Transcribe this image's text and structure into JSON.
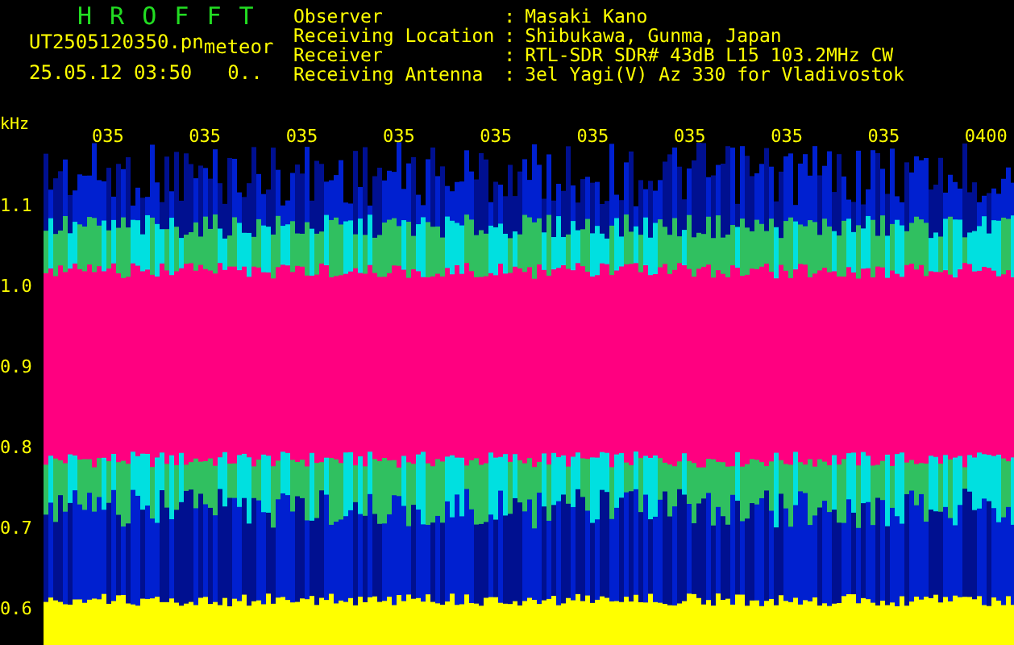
{
  "header": {
    "title": "H R O F F T",
    "filename": "UT2505120350.pn",
    "mode": "meteor",
    "datetime": "25.05.12 03:50",
    "code": "0.."
  },
  "info": [
    {
      "label": "Observer",
      "value": "Masaki Kano"
    },
    {
      "label": "Receiving Location",
      "value": "Shibukawa, Gunma, Japan"
    },
    {
      "label": "Receiver",
      "value": "RTL-SDR SDR# 43dB L15 103.2MHz CW"
    },
    {
      "label": "Receiving Antenna",
      "value": "3el Yagi(V) Az 330 for Vladivostok"
    }
  ],
  "separator": ":",
  "y_axis": {
    "unit": "kHz",
    "ticks": [
      "1.1",
      "1.0",
      "0.9",
      "0.8",
      "0.7",
      "0.6"
    ]
  },
  "time_labels": [
    "035",
    "035",
    "035",
    "035",
    "035",
    "035",
    "035",
    "035",
    "035",
    "0400"
  ]
}
